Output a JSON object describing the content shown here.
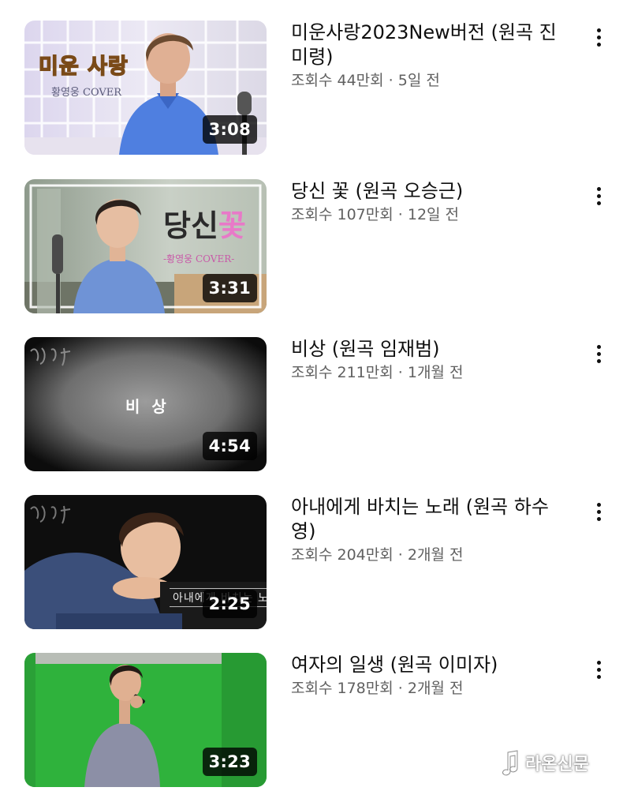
{
  "videos": [
    {
      "title": "미운사랑2023New버전 (원곡 진미령)",
      "views": "조회수 44만회",
      "age": "5일 전",
      "duration": "3:08",
      "thumb_title": "미운 사랑",
      "thumb_subtitle": "황영웅 COVER"
    },
    {
      "title": "당신 꽃 (원곡 오승근)",
      "views": "조회수 107만회",
      "age": "12일 전",
      "duration": "3:31",
      "thumb_title_1": "당신",
      "thumb_title_2": "꽃",
      "thumb_subtitle": "-황영웅 COVER-"
    },
    {
      "title": "비상 (원곡 임재범)",
      "views": "조회수 211만회",
      "age": "1개월 전",
      "duration": "4:54",
      "thumb_title": "비 상"
    },
    {
      "title": "아내에게 바치는 노래 (원곡 하수영)",
      "views": "조회수 204만회",
      "age": "2개월 전",
      "duration": "2:25",
      "thumb_title": "아내에게 바치는 노래"
    },
    {
      "title": "여자의 일생 (원곡 이미자)",
      "views": "조회수 178만회",
      "age": "2개월 전",
      "duration": "3:23"
    }
  ],
  "separator": "·",
  "watermark": "라온신문",
  "colors": {
    "title_text": "#0f0f0f",
    "meta_text": "#606060",
    "duration_bg": "#000000",
    "green_screen": "#2fb23c"
  },
  "icons": [
    "more-vert-icon",
    "music-note-icon"
  ]
}
